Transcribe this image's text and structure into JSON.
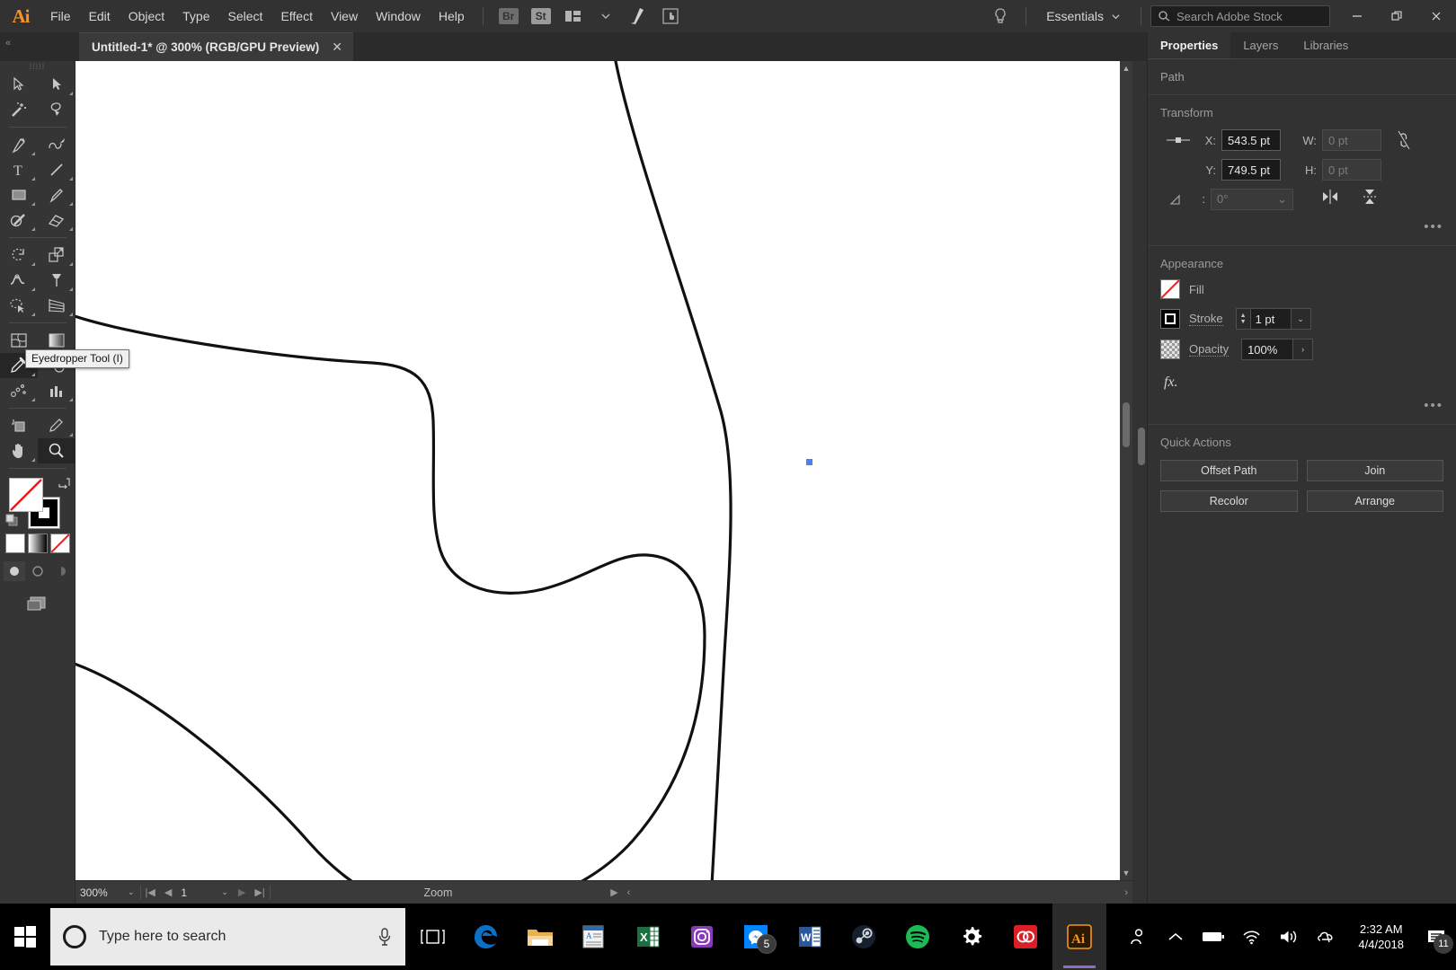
{
  "app": {
    "name": "Adobe Illustrator",
    "logo_text": "Ai",
    "accent": "#f79421"
  },
  "menubar": {
    "items": [
      "File",
      "Edit",
      "Object",
      "Type",
      "Select",
      "Effect",
      "View",
      "Window",
      "Help"
    ],
    "bridge_label": "Br",
    "stock_label": "St",
    "arrange_icon": "arrange-documents-icon",
    "chevron_icon": "chevron-down-icon",
    "ai_doc_icon": "illustrator-doc-icon",
    "touch_icon": "touch-workspace-icon",
    "lightbulb_icon": "lightbulb-icon",
    "workspace": "Essentials",
    "search_placeholder": "Search Adobe Stock",
    "search_icon": "search-icon",
    "window_controls": {
      "minimize": "minimize-icon",
      "restore": "restore-icon",
      "close": "close-icon"
    }
  },
  "tabbar": {
    "collapse_glyph": "«",
    "document_title": "Untitled-1* @ 300% (RGB/GPU Preview)",
    "close_glyph": "✕",
    "right_glyph": "»"
  },
  "toolbar": {
    "grip": "⁞⁞⁞⁞⁞",
    "tools": [
      {
        "name": "selection-tool",
        "flyout": false
      },
      {
        "name": "direct-selection-tool",
        "flyout": true
      },
      {
        "name": "magic-wand-tool",
        "flyout": false
      },
      {
        "name": "lasso-tool",
        "flyout": false
      },
      {
        "name": "pen-tool",
        "flyout": true
      },
      {
        "name": "curvature-tool",
        "flyout": false
      },
      {
        "name": "type-tool",
        "flyout": true
      },
      {
        "name": "line-segment-tool",
        "flyout": true
      },
      {
        "name": "rectangle-tool",
        "flyout": true
      },
      {
        "name": "paintbrush-tool",
        "flyout": true
      },
      {
        "name": "shaper-tool",
        "flyout": true
      },
      {
        "name": "eraser-tool",
        "flyout": true
      },
      {
        "name": "rotate-tool",
        "flyout": true
      },
      {
        "name": "scale-tool",
        "flyout": true
      },
      {
        "name": "width-tool",
        "flyout": true
      },
      {
        "name": "free-transform-tool",
        "flyout": true
      },
      {
        "name": "shape-builder-tool",
        "flyout": true
      },
      {
        "name": "perspective-grid-tool",
        "flyout": true
      },
      {
        "name": "mesh-tool",
        "flyout": false
      },
      {
        "name": "gradient-tool",
        "flyout": false
      },
      {
        "name": "eyedropper-tool",
        "flyout": true,
        "selected": true
      },
      {
        "name": "blend-tool",
        "flyout": false
      },
      {
        "name": "symbol-sprayer-tool",
        "flyout": true
      },
      {
        "name": "column-graph-tool",
        "flyout": true
      },
      {
        "name": "artboard-tool",
        "flyout": false
      },
      {
        "name": "slice-tool",
        "flyout": true
      },
      {
        "name": "hand-tool",
        "flyout": true
      },
      {
        "name": "zoom-tool",
        "flyout": false
      }
    ],
    "tooltip": "Eyedropper Tool (I)",
    "fill_swatch": "fill-none-swatch",
    "stroke_swatch": "stroke-black-swatch",
    "swap_icon": "swap-fill-stroke-icon",
    "default_icon": "default-fill-stroke-icon",
    "color_modes": [
      "color-swatch",
      "gradient-swatch",
      "none-swatch"
    ],
    "draw_modes": [
      "draw-normal",
      "draw-behind",
      "draw-inside"
    ],
    "screen_mode": "change-screen-mode-icon"
  },
  "canvas": {
    "anchor_point_color": "#4a7ffb",
    "artboard_bg": "#ffffff",
    "background": "#535353"
  },
  "statusbar": {
    "zoom_value": "300%",
    "zoom_caret": "⌄",
    "first_glyph": "|◀",
    "prev_glyph": "◀",
    "artboard_number": "1",
    "artboard_caret": "⌄",
    "next_glyph": "▶",
    "last_glyph": "▶|",
    "status_label": "Zoom",
    "play_glyph": "▶",
    "left_glyph": "‹",
    "right_glyph": "›"
  },
  "properties": {
    "tabs": [
      {
        "label": "Properties",
        "active": true
      },
      {
        "label": "Layers",
        "active": false
      },
      {
        "label": "Libraries",
        "active": false
      }
    ],
    "object_type": "Path",
    "transform": {
      "title": "Transform",
      "ref_point_icon": "reference-point-selector",
      "x_label": "X:",
      "x_value": "543.5 pt",
      "y_label": "Y:",
      "y_value": "749.5 pt",
      "w_label": "W:",
      "w_value": "0 pt",
      "h_label": "H:",
      "h_value": "0 pt",
      "link_icon": "constrain-proportions-unlinked-icon",
      "angle_label": "⊿:",
      "angle_value": "0°",
      "angle_caret": "⌄",
      "flip_horizontal_icon": "flip-horizontal-icon",
      "flip_vertical_icon": "flip-vertical-icon",
      "more_options": "•••"
    },
    "appearance": {
      "title": "Appearance",
      "fill_label": "Fill",
      "fill_swatch": "fill-none-swatch",
      "stroke_label": "Stroke",
      "stroke_swatch": "stroke-black-swatch",
      "stroke_weight": "1 pt",
      "stroke_caret": "⌄",
      "stepper_icon": "stepper-up-down-icon",
      "opacity_label": "Opacity",
      "opacity_value": "100%",
      "opacity_arrow": "›",
      "opacity_swatch": "transparency-checker-swatch",
      "fx_label": "fx.",
      "more_options": "•••"
    },
    "quick_actions": {
      "title": "Quick Actions",
      "buttons": [
        "Offset Path",
        "Join",
        "Recolor",
        "Arrange"
      ]
    }
  },
  "taskbar": {
    "start_icon": "windows-start-icon",
    "cortana_icon": "cortana-circle-icon",
    "search_placeholder": "Type here to search",
    "mic_icon": "microphone-icon",
    "apps": [
      {
        "name": "task-view-icon",
        "label": "Task View",
        "badge": null,
        "active": false
      },
      {
        "name": "microsoft-edge-icon",
        "label": "Microsoft Edge",
        "badge": null,
        "active": false
      },
      {
        "name": "file-explorer-icon",
        "label": "File Explorer",
        "badge": null,
        "active": false
      },
      {
        "name": "news-app-icon",
        "label": "News",
        "badge": null,
        "active": false
      },
      {
        "name": "microsoft-excel-icon",
        "label": "Excel",
        "badge": null,
        "active": false
      },
      {
        "name": "instagram-icon",
        "label": "Instagram",
        "badge": null,
        "active": false
      },
      {
        "name": "messenger-icon",
        "label": "Messenger",
        "badge": "5",
        "active": false
      },
      {
        "name": "microsoft-word-icon",
        "label": "Word",
        "badge": null,
        "active": false
      },
      {
        "name": "steam-icon",
        "label": "Steam",
        "badge": null,
        "active": false
      },
      {
        "name": "spotify-icon",
        "label": "Spotify",
        "badge": null,
        "active": false
      },
      {
        "name": "settings-gear-icon",
        "label": "Settings",
        "badge": null,
        "active": false
      },
      {
        "name": "creative-cloud-icon",
        "label": "Creative Cloud",
        "badge": null,
        "active": false
      },
      {
        "name": "illustrator-taskbar-icon",
        "label": "Adobe Illustrator",
        "badge": null,
        "active": true
      }
    ],
    "tray": {
      "people_icon": "people-icon",
      "chevron_up_icon": "show-hidden-icons-icon",
      "battery_icon": "battery-icon",
      "wifi_icon": "wifi-icon",
      "volume_icon": "volume-icon",
      "onedrive_icon": "onedrive-icon",
      "time": "2:32 AM",
      "date": "4/4/2018",
      "notification_icon": "action-center-icon",
      "notification_count": "11"
    }
  }
}
